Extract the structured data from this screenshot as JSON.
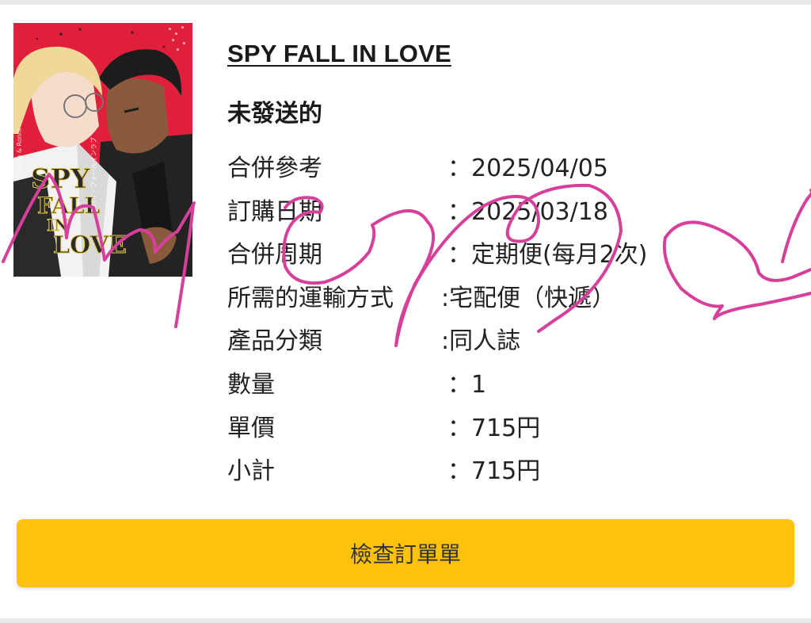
{
  "product": {
    "title": "SPY FALL IN LOVE",
    "status": "未發送的",
    "cover": {
      "title_lines": [
        "SPY",
        "FALL",
        "IN",
        "LOVE"
      ],
      "author_text": "Smith & Ronni",
      "subtitle_jp": "スパイ・フォールインラブ",
      "colors": {
        "background": "#e0203a",
        "hair_blond": "#efd89a",
        "hair_dark": "#1c1c1c",
        "skin_tan": "#8a5a3c",
        "skin_light": "#f6dccb",
        "clothes": "#232323"
      }
    }
  },
  "details": [
    {
      "label": "合併參考",
      "sep": "：",
      "value": "2025/04/05"
    },
    {
      "label": "訂購日期",
      "sep": "：",
      "value": "2025/03/18"
    },
    {
      "label": "合併周期",
      "sep": "：",
      "value": "定期便(每月2次)"
    },
    {
      "label": "所需的運輸方式",
      "sep": ":",
      "value": "宅配便（快遞）"
    },
    {
      "label": "產品分類",
      "sep": ":",
      "value": "同人誌"
    },
    {
      "label": "數量",
      "sep": "：",
      "value": "1"
    },
    {
      "label": "單價",
      "sep": "：",
      "value": "715円"
    },
    {
      "label": "小計",
      "sep": "：",
      "value": "715円"
    }
  ],
  "actions": {
    "check_order_label": "檢查訂單單"
  },
  "theme": {
    "button_color": "#fcc20d",
    "scribble_color": "#d6409a"
  }
}
